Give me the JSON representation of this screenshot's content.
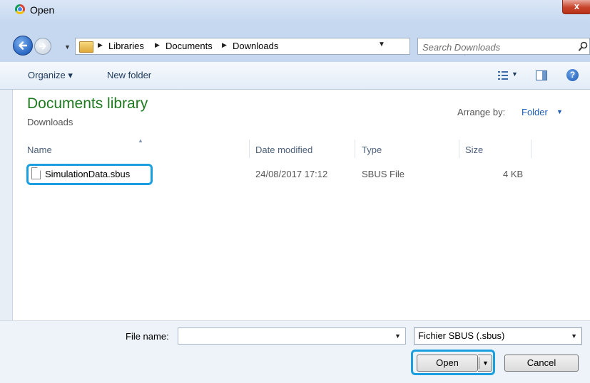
{
  "window": {
    "title": "Open",
    "close_glyph": "x"
  },
  "address": {
    "crumbs": [
      "Libraries",
      "Documents",
      "Downloads"
    ],
    "search_placeholder": "Search Downloads"
  },
  "toolbar": {
    "organize_label": "Organize ▾",
    "new_folder_label": "New folder",
    "help_glyph": "?"
  },
  "library": {
    "title": "Documents library",
    "subtitle": "Downloads",
    "arrange_label": "Arrange by:",
    "arrange_value": "Folder"
  },
  "columns": {
    "name": "Name",
    "date": "Date modified",
    "type": "Type",
    "size": "Size"
  },
  "files": [
    {
      "name": "SimulationData.sbus",
      "date": "24/08/2017 17:12",
      "type": "SBUS File",
      "size": "4 KB"
    }
  ],
  "footer": {
    "filename_label": "File name:",
    "filename_value": "",
    "filetype_value": "Fichier SBUS (.sbus)",
    "open_label": "Open",
    "cancel_label": "Cancel"
  },
  "colors": {
    "highlight": "#1aa0e0",
    "library_title": "#1e7a1e",
    "link": "#1e5fb8"
  },
  "icons": [
    "chrome-app-icon",
    "back-arrow-icon",
    "forward-arrow-icon",
    "folder-icon",
    "refresh-icon",
    "search-icon",
    "view-options-icon",
    "preview-pane-icon",
    "help-icon",
    "file-icon"
  ]
}
